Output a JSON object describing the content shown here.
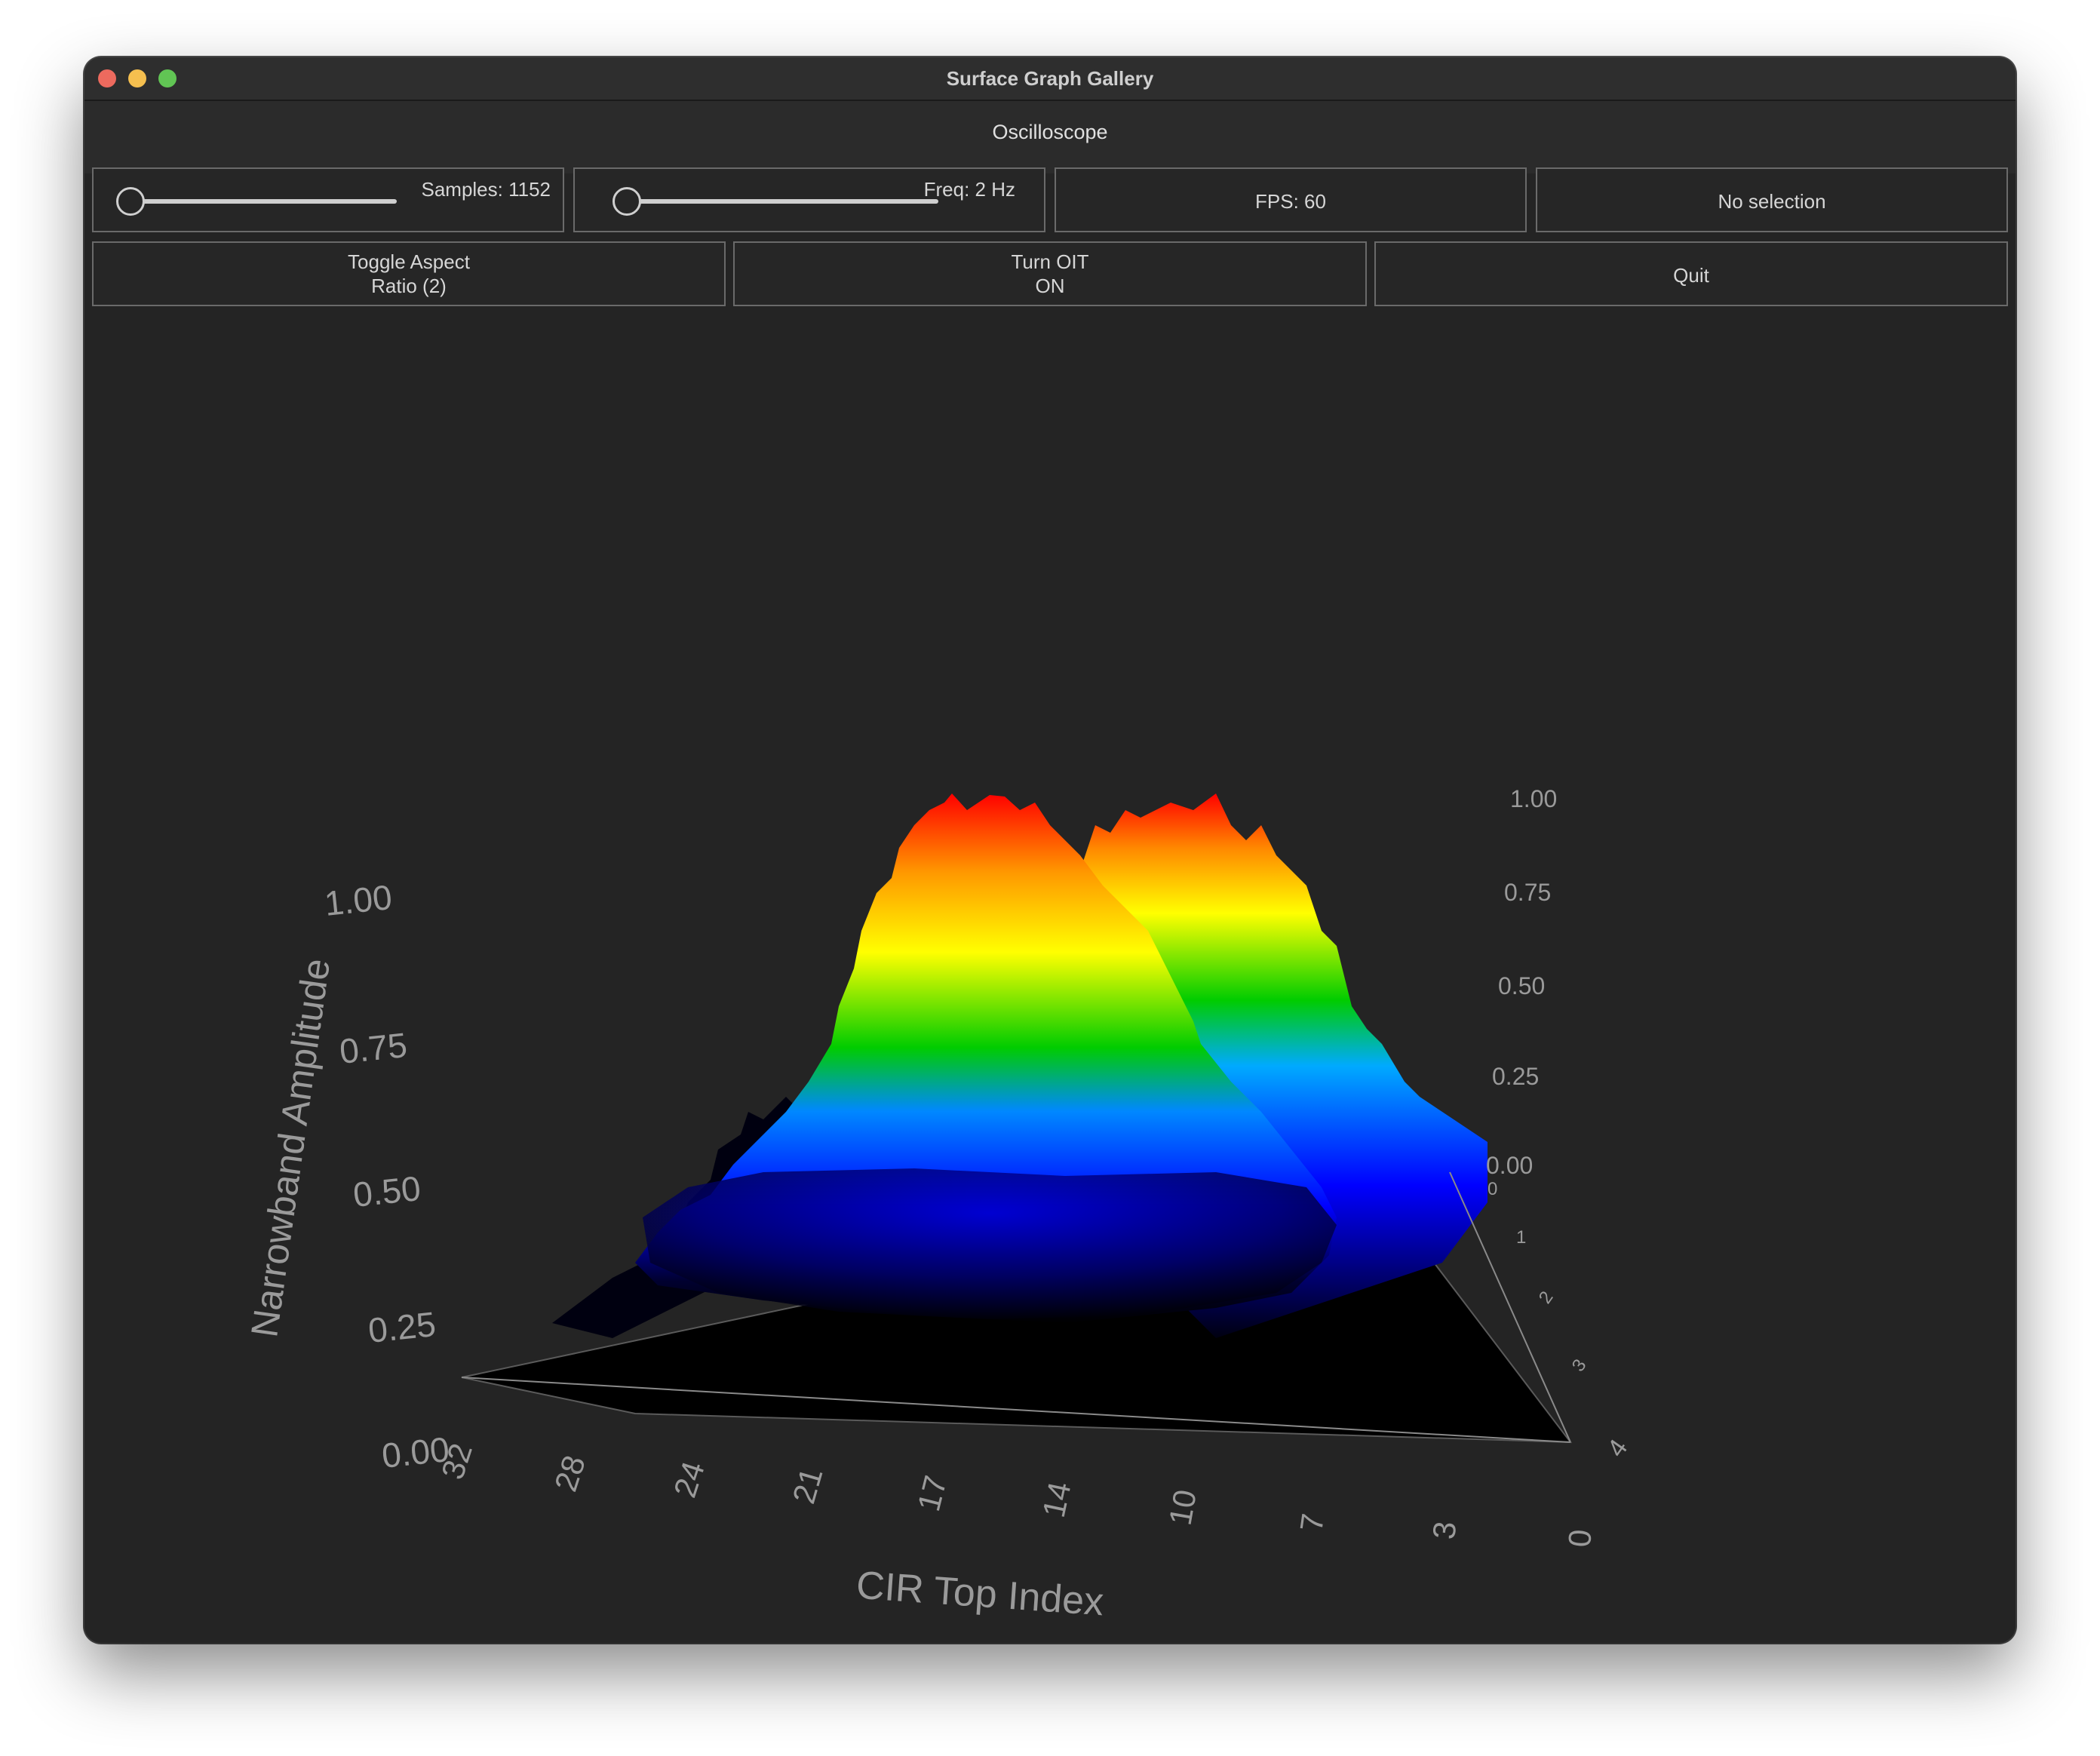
{
  "window": {
    "title": "Surface Graph Gallery"
  },
  "tab": {
    "label": "Oscilloscope"
  },
  "controls": {
    "samples_label": "Samples: 1152",
    "freq_label": "Freq: 2 Hz",
    "fps_label": "FPS: 60",
    "selection_label": "No selection",
    "toggle_aspect_line1": "Toggle Aspect",
    "toggle_aspect_line2": "Ratio (2)",
    "oit_line1": "Turn OIT",
    "oit_line2": "ON",
    "quit_label": "Quit"
  },
  "graph": {
    "y_axis_title": "Narrowband Amplitude",
    "x_axis_title": "CIR Top Index",
    "y_ticks_left": [
      "1.00",
      "0.75",
      "0.50",
      "0.25",
      "0.00"
    ],
    "y_ticks_right": [
      "1.00",
      "0.75",
      "0.50",
      "0.25",
      "0.00"
    ],
    "x_ticks": [
      "32",
      "28",
      "24",
      "21",
      "17",
      "14",
      "10",
      "7",
      "3",
      "0"
    ],
    "z_ticks": [
      "0",
      "1",
      "2",
      "3",
      "4"
    ],
    "gradient_colors": [
      "#000000",
      "#0000ff",
      "#00ff00",
      "#ffff00",
      "#ff0000"
    ]
  }
}
